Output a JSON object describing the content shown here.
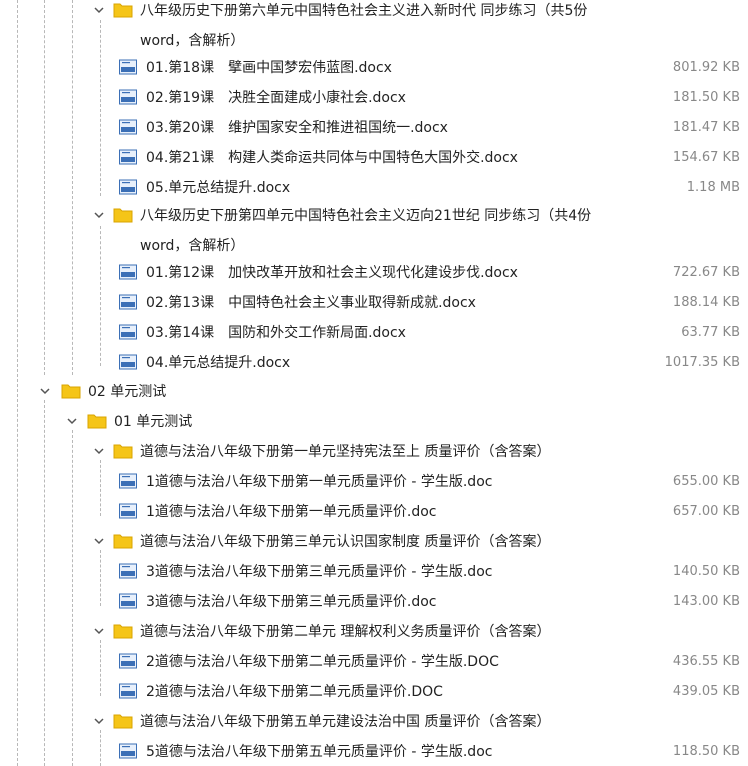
{
  "tree": {
    "groupA": {
      "title": "八年级历史下册第六单元中国特色社会主义进入新时代 同步练习（共5份word，含解析）",
      "files": [
        {
          "name": "01.第18课　擘画中国梦宏伟蓝图.docx",
          "size": "801.92 KB"
        },
        {
          "name": "02.第19课　决胜全面建成小康社会.docx",
          "size": "181.50 KB"
        },
        {
          "name": "03.第20课　维护国家安全和推进祖国统一.docx",
          "size": "181.47 KB"
        },
        {
          "name": "04.第21课　构建人类命运共同体与中国特色大国外交.docx",
          "size": "154.67 KB"
        },
        {
          "name": "05.单元总结提升.docx",
          "size": "1.18 MB"
        }
      ]
    },
    "groupB": {
      "title": "八年级历史下册第四单元中国特色社会主义迈向21世纪 同步练习（共4份word，含解析）",
      "files": [
        {
          "name": "01.第12课　加快改革开放和社会主义现代化建设步伐.docx",
          "size": "722.67 KB"
        },
        {
          "name": "02.第13课　中国特色社会主义事业取得新成就.docx",
          "size": "188.14 KB"
        },
        {
          "name": "03.第14课　国防和外交工作新局面.docx",
          "size": "63.77 KB"
        },
        {
          "name": "04.单元总结提升.docx",
          "size": "1017.35 KB"
        }
      ]
    },
    "folder02": {
      "title": "02 单元测试"
    },
    "folder01": {
      "title": "01 单元测试"
    },
    "groupC": {
      "title": "道德与法治八年级下册第一单元坚持宪法至上 质量评价（含答案）",
      "files": [
        {
          "name": "1道德与法治八年级下册第一单元质量评价 - 学生版.doc",
          "size": "655.00 KB"
        },
        {
          "name": "1道德与法治八年级下册第一单元质量评价.doc",
          "size": "657.00 KB"
        }
      ]
    },
    "groupD": {
      "title": "道德与法治八年级下册第三单元认识国家制度 质量评价（含答案）",
      "files": [
        {
          "name": "3道德与法治八年级下册第三单元质量评价 - 学生版.doc",
          "size": "140.50 KB"
        },
        {
          "name": "3道德与法治八年级下册第三单元质量评价.doc",
          "size": "143.00 KB"
        }
      ]
    },
    "groupE": {
      "title": "道德与法治八年级下册第二单元 理解权利义务质量评价（含答案）",
      "files": [
        {
          "name": "2道德与法治八年级下册第二单元质量评价 - 学生版.DOC",
          "size": "436.55 KB"
        },
        {
          "name": "2道德与法治八年级下册第二单元质量评价.DOC",
          "size": "439.05 KB"
        }
      ]
    },
    "groupF": {
      "title": "道德与法治八年级下册第五单元建设法治中国 质量评价（含答案）",
      "files": [
        {
          "name": "5道德与法治八年级下册第五单元质量评价 - 学生版.doc",
          "size": "118.50 KB"
        }
      ]
    }
  },
  "icons": {
    "folder": "folder-icon",
    "doc": "word-doc-icon",
    "expand": "chevron-down-icon"
  },
  "colors": {
    "folder": "#f5c518",
    "doc_blue": "#3b6fb6",
    "size_text": "#888888",
    "guide": "#b8b8b8"
  }
}
